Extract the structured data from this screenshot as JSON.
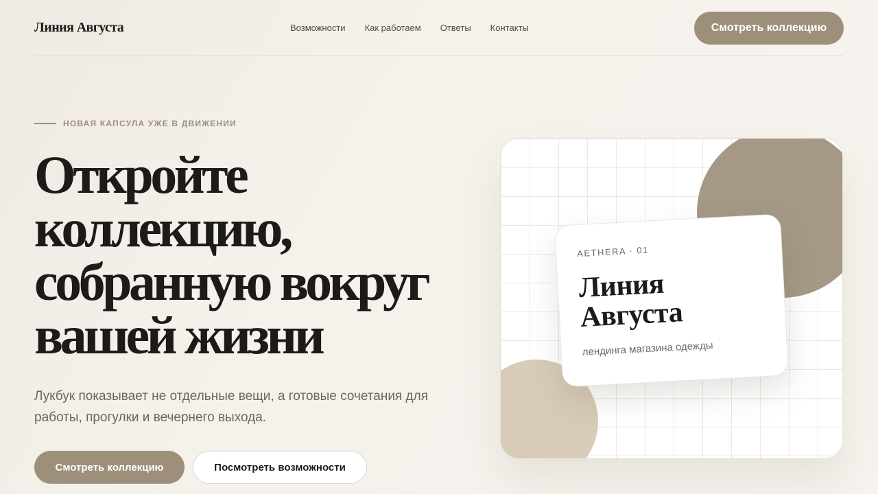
{
  "header": {
    "brand": "Линия Августа",
    "nav": [
      "Возможности",
      "Как работаем",
      "Ответы",
      "Контакты"
    ],
    "cta_label": "Смотреть коллекцию"
  },
  "hero": {
    "eyebrow": "НОВАЯ КАПСУЛА УЖЕ В ДВИЖЕНИИ",
    "title_lines": [
      "Откройте",
      "коллекцию,",
      "собранную вокруг",
      "вашей жизни"
    ],
    "subtitle": "Лукбук показывает не отдельные вещи, а готовые сочетания для работы, прогулки и вечернего выхода.",
    "primary_button": "Смотреть коллекцию",
    "secondary_button": "Посмотреть возможности"
  },
  "visual": {
    "card": {
      "meta": "AETHERA · 01",
      "title_lines": [
        "Линия",
        "Августа"
      ],
      "subtitle": "лендинга магазина одежды"
    }
  },
  "colors": {
    "accent": "#9e8f7a",
    "text": "#1c1b19",
    "muted": "#6a655e",
    "circle_dark": "#a59886",
    "circle_light": "#d8cbb8",
    "background": "#f5f2ec"
  }
}
